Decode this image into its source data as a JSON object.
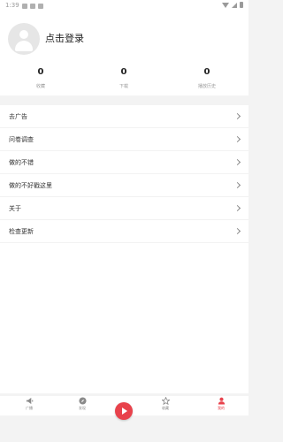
{
  "status_bar": {
    "time": "1:39",
    "icons": [
      "notification-icon",
      "notification-icon",
      "notification-icon",
      "wifi-icon",
      "signal-icon",
      "battery-icon"
    ]
  },
  "profile": {
    "avatar_icon": "user-avatar-icon",
    "login_label": "点击登录"
  },
  "stats": [
    {
      "value": "0",
      "label": "收藏"
    },
    {
      "value": "0",
      "label": "下载"
    },
    {
      "value": "0",
      "label": "播放历史"
    }
  ],
  "menu": {
    "items": [
      {
        "label": "去广告",
        "icon": "chevron-right-icon"
      },
      {
        "label": "问卷调查",
        "icon": "chevron-right-icon"
      },
      {
        "label": "做的不错",
        "icon": "chevron-right-icon"
      },
      {
        "label": "做的不好戳这里",
        "icon": "chevron-right-icon"
      },
      {
        "label": "关于",
        "icon": "chevron-right-icon"
      },
      {
        "label": "检查更新",
        "icon": "chevron-right-icon"
      }
    ]
  },
  "bottom_nav": {
    "items": [
      {
        "label": "广播",
        "icon": "megaphone-icon",
        "active": false
      },
      {
        "label": "发现",
        "icon": "compass-icon",
        "active": false
      },
      {
        "label": "收藏",
        "icon": "star-icon",
        "active": false
      },
      {
        "label": "我的",
        "icon": "person-icon",
        "active": true
      }
    ],
    "play_icon": "play-icon"
  },
  "colors": {
    "accent": "#e8424c",
    "background": "#f3f3f3",
    "surface": "#ffffff",
    "muted_text": "#999999"
  }
}
